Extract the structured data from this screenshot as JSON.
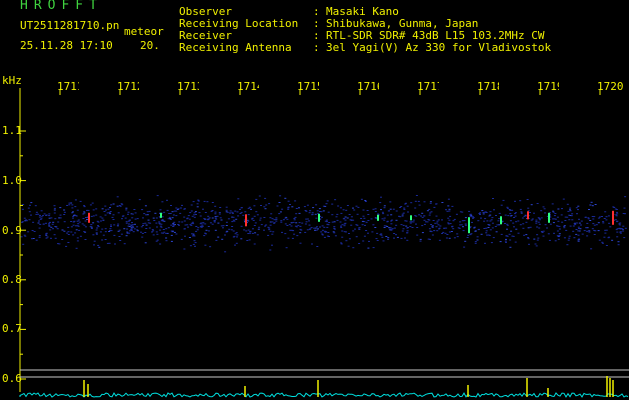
{
  "header": {
    "title": "HROFFT",
    "filename": "UT2511281710.pn",
    "meteor_label": "meteor",
    "datetime": "25.11.28 17:10",
    "count": "20."
  },
  "info": [
    {
      "label": "Observer",
      "value": "Masaki Kano"
    },
    {
      "label": "Receiving Location",
      "value": "Shibukawa, Gunma, Japan"
    },
    {
      "label": "Receiver",
      "value": "RTL-SDR SDR# 43dB L15 103.2MHz CW"
    },
    {
      "label": "Receiving Antenna",
      "value": "3el Yagi(V) Az 330 for Vladivostok"
    }
  ],
  "chart_data": {
    "type": "heatmap",
    "y_unit_label": "kHz",
    "x_ticks": [
      "1711",
      "1712",
      "1713",
      "1714",
      "1715",
      "1716",
      "1717",
      "1718",
      "1719",
      "1720"
    ],
    "y_ticks": [
      "1.1",
      "1.0",
      "0.9",
      "0.8",
      "0.7",
      "0.6"
    ],
    "ylim": [
      0.6,
      1.1
    ],
    "signal_band_khz": [
      0.85,
      0.98
    ],
    "colors": {
      "axis": "#f0f000",
      "header_green": "#3fd33f",
      "text_yellow": "#f0f000",
      "noise": "#1a2a9a",
      "meteor_hot": "#ff3030",
      "meteor_mid": "#30ff80",
      "spectrum": "#00e0e0",
      "spectrum_peak": "#f0f000"
    }
  }
}
